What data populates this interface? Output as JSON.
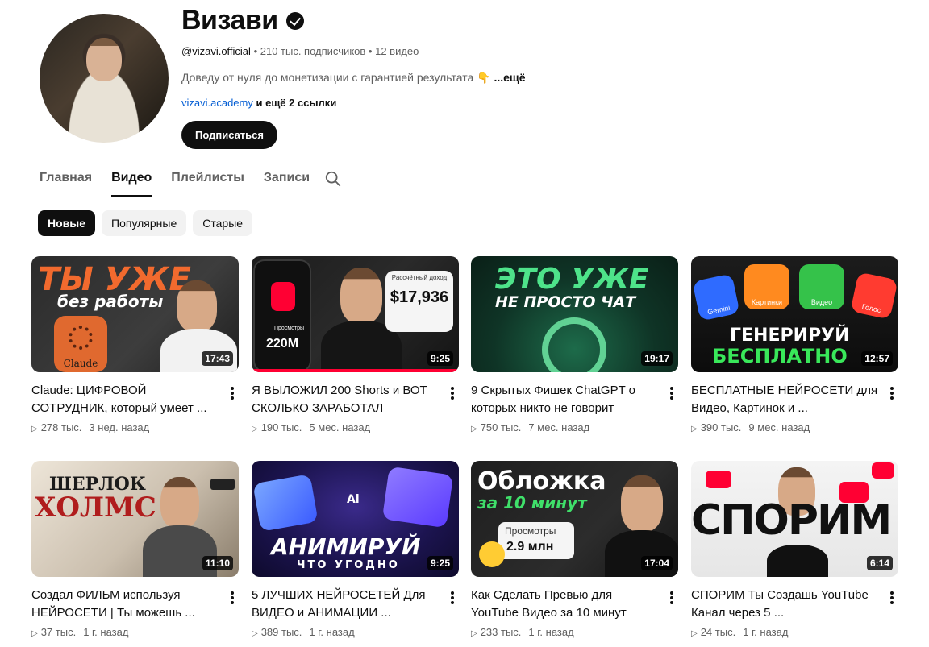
{
  "channel": {
    "name": "Визави",
    "handle": "@vizavi.official",
    "subscribers": "210 тыс. подписчиков",
    "video_count": "12 видео",
    "description": "Доведу от нуля до монетизации с гарантией результата 👇",
    "more": "...ещё",
    "link": "vizavi.academy",
    "more_links": "и ещё 2 ссылки",
    "subscribe_label": "Подписаться"
  },
  "tabs": [
    {
      "label": "Главная"
    },
    {
      "label": "Видео"
    },
    {
      "label": "Плейлисты"
    },
    {
      "label": "Записи"
    }
  ],
  "chips": [
    {
      "label": "Новые"
    },
    {
      "label": "Популярные"
    },
    {
      "label": "Старые"
    }
  ],
  "videos": [
    {
      "title": "Claude: ЦИФРОВОЙ СОТРУДНИК, который умеет ...",
      "views": "278 тыс.",
      "age": "3 нед. назад",
      "duration": "17:43",
      "thumb_text": [
        "ТЫ УЖЕ",
        "без работы",
        "Claude"
      ]
    },
    {
      "title": "Я ВЫЛОЖИЛ 200 Shorts и ВОТ СКОЛЬКО ЗАРАБОТАЛ",
      "views": "190 тыс.",
      "age": "5 мес. назад",
      "duration": "9:25",
      "thumb_text": [
        "Рассчётный доход",
        "$17,936",
        "Просмотры",
        "220M"
      ],
      "watched_fraction": 1.0
    },
    {
      "title": "9 Скрытых Фишек ChatGPT о которых никто не говорит",
      "views": "750 тыс.",
      "age": "7 мес. назад",
      "duration": "19:17",
      "thumb_text": [
        "ЭТО УЖЕ",
        "НЕ ПРОСТО ЧАТ"
      ]
    },
    {
      "title": "БЕСПЛАТНЫЕ НЕЙРОСЕТИ для Видео, Картинок и ...",
      "views": "390 тыс.",
      "age": "9 мес. назад",
      "duration": "12:57",
      "thumb_text": [
        "Gemini",
        "Картинки",
        "Видео",
        "Голос",
        "ГЕНЕРИРУЙ",
        "БЕСПЛАТНО"
      ]
    },
    {
      "title": "Создал ФИЛЬМ используя НЕЙРОСЕТИ | Ты можешь ...",
      "views": "37 тыс.",
      "age": "1 г. назад",
      "duration": "11:10",
      "thumb_text": [
        "ШЕРЛОК",
        "ХОЛМС"
      ]
    },
    {
      "title": "5 ЛУЧШИХ НЕЙРОСЕТЕЙ Для ВИДЕО и АНИМАЦИИ ...",
      "views": "389 тыс.",
      "age": "1 г. назад",
      "duration": "9:25",
      "thumb_text": [
        "Ai",
        "АНИМИРУЙ",
        "ЧТО УГОДНО"
      ]
    },
    {
      "title": "Как Сделать Превью для YouTube Видео за 10 минут",
      "views": "233 тыс.",
      "age": "1 г. назад",
      "duration": "17:04",
      "thumb_text": [
        "Обложка",
        "за 10 минут",
        "Просмотры",
        "2.9 млн"
      ]
    },
    {
      "title": "СПОРИМ Ты Создашь YouTube Канал через 5 ...",
      "views": "24 тыс.",
      "age": "1 г. назад",
      "duration": "6:14",
      "thumb_text": [
        "СПОРИМ"
      ]
    }
  ],
  "icons": {
    "verified": "verified-badge-icon",
    "search": "search-icon",
    "play": "play-triangle-icon",
    "more": "more-vertical-icon"
  },
  "colors": {
    "link": "#065fd4",
    "accent": "#0f0f0f",
    "progress": "#ff0033"
  }
}
